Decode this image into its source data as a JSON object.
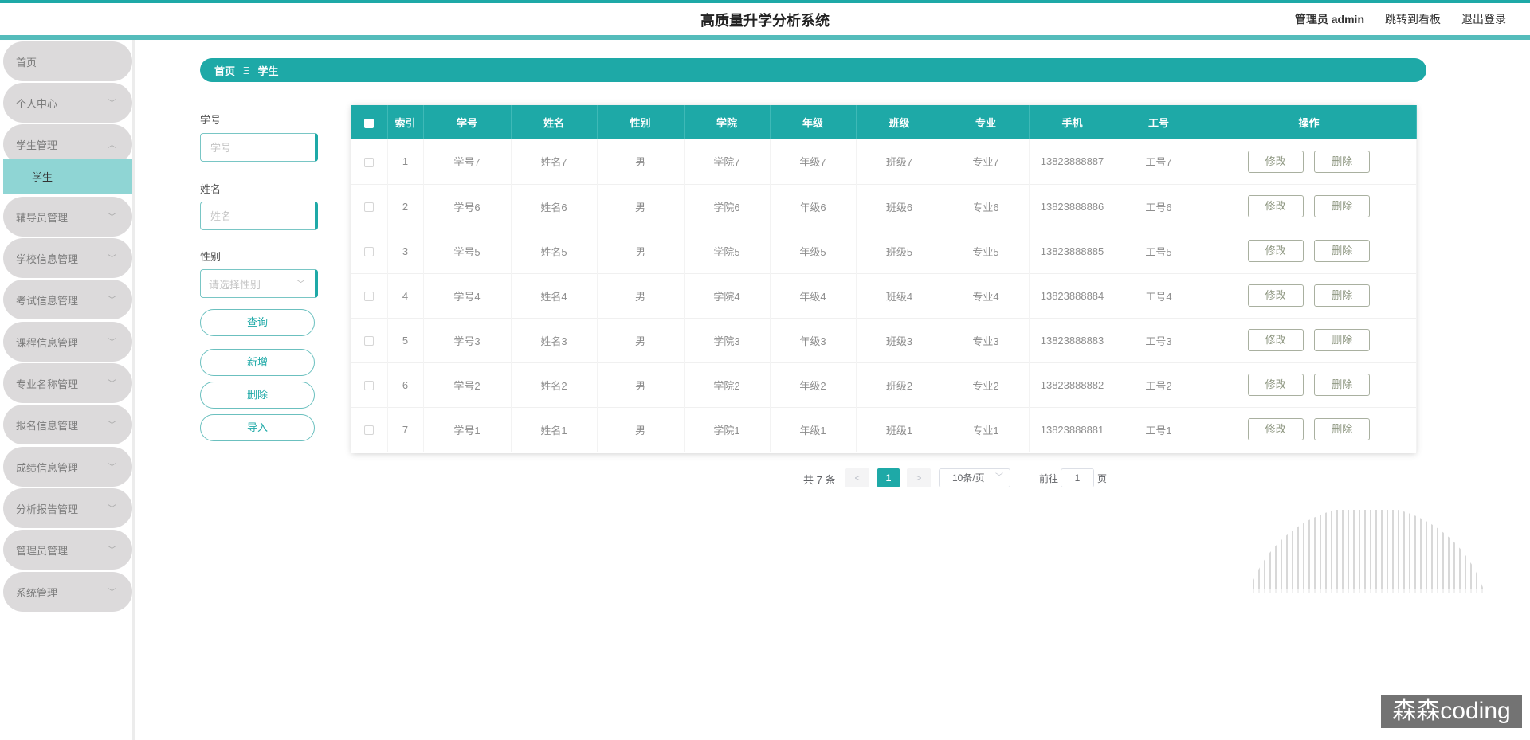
{
  "header": {
    "title": "高质量升学分析系统",
    "admin_label": "管理员 admin",
    "dashboard_link": "跳转到看板",
    "logout_link": "退出登录"
  },
  "sidebar": {
    "items": [
      {
        "label": "首页",
        "chevron": ""
      },
      {
        "label": "个人中心",
        "chevron": "﹀"
      },
      {
        "label": "学生管理",
        "chevron": "︿"
      },
      {
        "label": "辅导员管理",
        "chevron": "﹀"
      },
      {
        "label": "学校信息管理",
        "chevron": "﹀"
      },
      {
        "label": "考试信息管理",
        "chevron": "﹀"
      },
      {
        "label": "课程信息管理",
        "chevron": "﹀"
      },
      {
        "label": "专业名称管理",
        "chevron": "﹀"
      },
      {
        "label": "报名信息管理",
        "chevron": "﹀"
      },
      {
        "label": "成绩信息管理",
        "chevron": "﹀"
      },
      {
        "label": "分析报告管理",
        "chevron": "﹀"
      },
      {
        "label": "管理员管理",
        "chevron": "﹀"
      },
      {
        "label": "系统管理",
        "chevron": "﹀"
      }
    ],
    "active_sub": "学生"
  },
  "breadcrumb": {
    "home": "首页",
    "separator": "Ξ",
    "current": "学生"
  },
  "search": {
    "student_id_label": "学号",
    "student_id_placeholder": "学号",
    "name_label": "姓名",
    "name_placeholder": "姓名",
    "gender_label": "性别",
    "gender_placeholder": "请选择性别",
    "query_button": "查询",
    "add_button": "新增",
    "delete_button": "删除",
    "import_button": "导入"
  },
  "table": {
    "headers": [
      "索引",
      "学号",
      "姓名",
      "性别",
      "学院",
      "年级",
      "班级",
      "专业",
      "手机",
      "工号",
      "操作"
    ],
    "rows": [
      {
        "index": "1",
        "student_id": "学号7",
        "name": "姓名7",
        "gender": "男",
        "college": "学院7",
        "grade": "年级7",
        "class": "班级7",
        "major": "专业7",
        "phone": "13823888887",
        "staff_id": "工号7"
      },
      {
        "index": "2",
        "student_id": "学号6",
        "name": "姓名6",
        "gender": "男",
        "college": "学院6",
        "grade": "年级6",
        "class": "班级6",
        "major": "专业6",
        "phone": "13823888886",
        "staff_id": "工号6"
      },
      {
        "index": "3",
        "student_id": "学号5",
        "name": "姓名5",
        "gender": "男",
        "college": "学院5",
        "grade": "年级5",
        "class": "班级5",
        "major": "专业5",
        "phone": "13823888885",
        "staff_id": "工号5"
      },
      {
        "index": "4",
        "student_id": "学号4",
        "name": "姓名4",
        "gender": "男",
        "college": "学院4",
        "grade": "年级4",
        "class": "班级4",
        "major": "专业4",
        "phone": "13823888884",
        "staff_id": "工号4"
      },
      {
        "index": "5",
        "student_id": "学号3",
        "name": "姓名3",
        "gender": "男",
        "college": "学院3",
        "grade": "年级3",
        "class": "班级3",
        "major": "专业3",
        "phone": "13823888883",
        "staff_id": "工号3"
      },
      {
        "index": "6",
        "student_id": "学号2",
        "name": "姓名2",
        "gender": "男",
        "college": "学院2",
        "grade": "年级2",
        "class": "班级2",
        "major": "专业2",
        "phone": "13823888882",
        "staff_id": "工号2"
      },
      {
        "index": "7",
        "student_id": "学号1",
        "name": "姓名1",
        "gender": "男",
        "college": "学院1",
        "grade": "年级1",
        "class": "班级1",
        "major": "专业1",
        "phone": "13823888881",
        "staff_id": "工号1"
      }
    ],
    "edit_label": "修改",
    "delete_label": "删除"
  },
  "pagination": {
    "total": "共 7 条",
    "prev": "<",
    "current_page": "1",
    "next": ">",
    "page_size": "10条/页",
    "goto_label": "前往",
    "goto_value": "1",
    "goto_suffix": "页"
  },
  "watermark": "森森coding",
  "colors": {
    "accent": "#1ea9a7",
    "accent_light": "#8fd5d4",
    "menu_bg": "#dcdadb"
  },
  "icons": {
    "chevron": "chevron-down-icon",
    "checkbox": "checkbox-icon"
  }
}
